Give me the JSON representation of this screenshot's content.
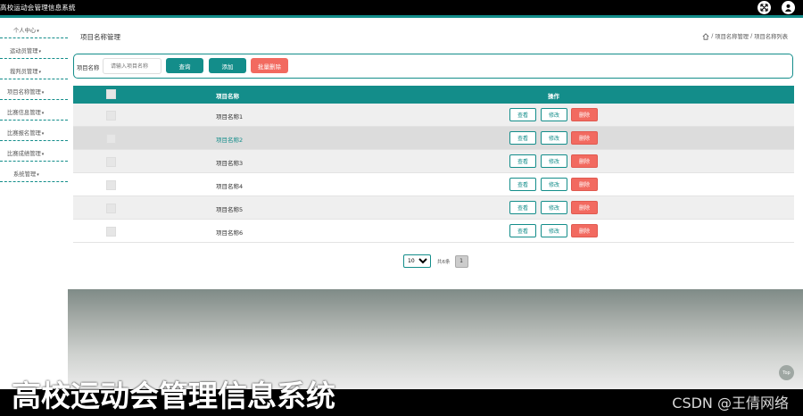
{
  "app": {
    "title": "高校运动会管理信息系统"
  },
  "colors": {
    "accent": "#138d8a",
    "danger": "#f26a60",
    "topbar": "#000000"
  },
  "topbar": {
    "icons": [
      "fullscreen-icon",
      "user-icon"
    ]
  },
  "sidebar": {
    "items": [
      {
        "label": "个人中心"
      },
      {
        "label": "运动员管理"
      },
      {
        "label": "裁判员管理"
      },
      {
        "label": "项目名称管理"
      },
      {
        "label": "比赛信息管理"
      },
      {
        "label": "比赛报名管理"
      },
      {
        "label": "比赛成绩管理"
      },
      {
        "label": "系统管理"
      }
    ]
  },
  "main": {
    "page_title": "项目名称管理",
    "breadcrumb": [
      "项目名称管理",
      "项目名称列表"
    ]
  },
  "search": {
    "label": "项目名称",
    "placeholder": "请输入项目名称",
    "query_button": "查询",
    "add_button": "添加",
    "batch_delete_button": "批量删除"
  },
  "table": {
    "headers": {
      "name": "项目名称",
      "actions": "操作"
    },
    "rows": [
      {
        "name": "项目名称1"
      },
      {
        "name": "项目名称2"
      },
      {
        "name": "项目名称3"
      },
      {
        "name": "项目名称4"
      },
      {
        "name": "项目名称5"
      },
      {
        "name": "项目名称6"
      }
    ],
    "action_labels": {
      "view": "查看",
      "edit": "修改",
      "delete": "删除"
    }
  },
  "pagination": {
    "page_size": "10",
    "total_text": "共6条",
    "current_page": "1"
  },
  "back_to_top": "Top",
  "video": {
    "caption": "高校运动会管理信息系统",
    "watermark": "CSDN @王倩网络"
  }
}
